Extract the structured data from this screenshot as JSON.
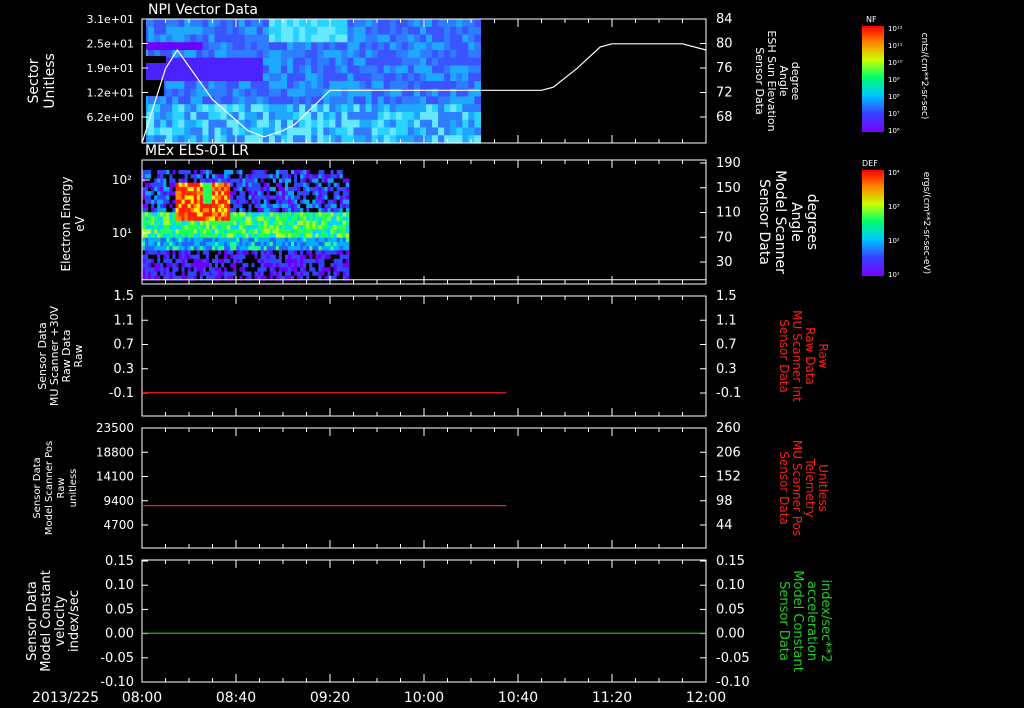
{
  "colors": {
    "white": "#ffffff",
    "red": "#ff1a1a",
    "green": "#22cc22",
    "bg": "#000000"
  },
  "date_label": "2013/225",
  "time_ticks": [
    "08:00",
    "08:40",
    "09:20",
    "10:00",
    "10:40",
    "11:20",
    "12:00"
  ],
  "time_range": [
    "08:00",
    "12:00"
  ],
  "colorbars": [
    {
      "name": "NF",
      "units": "cnts/(cm**2-sr-sec)",
      "ticks": [
        "10¹²",
        "10¹¹",
        "10¹⁰",
        "10⁹",
        "10⁸",
        "10⁷",
        "10⁶"
      ]
    },
    {
      "name": "DEF",
      "units": "ergs/(cm**2-sr-sec-eV)",
      "ticks": [
        "10⁴",
        "10³",
        "10²",
        "10¹"
      ]
    }
  ],
  "chart_data": [
    {
      "type": "heatmap",
      "title": "NPI Vector Data",
      "ylabel": [
        "Sector",
        "Unitless"
      ],
      "yticks": [
        "3.1e+01",
        "2.5e+01",
        "1.9e+01",
        "1.2e+01",
        "6.2e+00"
      ],
      "data_end": "10:24",
      "overlay": {
        "ylabel": [
          "Sensor Data",
          "ESH Sun Elevation",
          "Angle",
          "degree"
        ],
        "ylim": [
          64,
          84
        ],
        "yticks": [
          "84",
          "80",
          "76",
          "72",
          "68"
        ],
        "x": [
          "08:00",
          "08:10",
          "08:15",
          "08:30",
          "08:45",
          "08:52",
          "09:00",
          "09:05",
          "09:20",
          "10:50",
          "10:55",
          "11:05",
          "11:15",
          "11:20",
          "11:50",
          "12:00"
        ],
        "values": [
          64,
          76,
          79,
          71,
          66,
          65,
          66,
          67,
          72.5,
          72.5,
          73,
          76,
          79.5,
          80,
          80,
          79
        ]
      }
    },
    {
      "type": "heatmap",
      "title": "MEx ELS-01 LR",
      "ylabel": [
        "Electron Energy",
        "eV"
      ],
      "yticks": [
        "10²",
        "10¹"
      ],
      "data_end": "09:28",
      "overlay": {
        "ylabel": [
          "Sensor Data",
          "Model Scanner",
          "Angle",
          "degrees"
        ],
        "ylim": [
          10,
          190
        ],
        "yticks": [
          "190",
          "150",
          "110",
          "70",
          "30"
        ],
        "x": [
          "08:00",
          "12:00"
        ],
        "values": [
          10.5,
          10.5
        ]
      }
    },
    {
      "type": "line",
      "ylabel": [
        "Sensor Data",
        "MU Scanner +30V",
        "Raw Data",
        "Raw"
      ],
      "ylim": [
        -0.3,
        1.5
      ],
      "yticks": [
        "1.5",
        "1.1",
        "0.7",
        "0.3",
        "-0.1"
      ],
      "series": [
        {
          "x": [
            "08:00",
            "10:35"
          ],
          "values": [
            0.05,
            0.05
          ]
        }
      ],
      "right": {
        "ylabel": [
          "Sensor Data",
          "MU Scanner Int",
          "Raw Data",
          "Raw"
        ],
        "yticks": [
          "1.5",
          "1.1",
          "0.7",
          "0.3",
          "-0.1"
        ]
      }
    },
    {
      "type": "line",
      "ylabel": [
        "Sensor Data",
        "Model Scanner Pos",
        "Raw",
        "unitless"
      ],
      "ylim": [
        0,
        23500
      ],
      "yticks": [
        "23500",
        "18800",
        "14100",
        "9400",
        "4700"
      ],
      "series": [
        {
          "x": [
            "08:00",
            "10:35"
          ],
          "values": [
            8300,
            8300
          ]
        }
      ],
      "right": {
        "ylabel": [
          "Sensor Data",
          "MU Scanner Pos",
          "Telemetry",
          "Unitless"
        ],
        "yticks": [
          "260",
          "206",
          "152",
          "98",
          "44"
        ]
      }
    },
    {
      "type": "line",
      "ylabel": [
        "Sensor Data",
        "Model Constant",
        "velocity",
        "index/sec"
      ],
      "ylim": [
        -0.1,
        0.15
      ],
      "yticks": [
        "0.15",
        "0.10",
        "0.05",
        "0.00",
        "-0.05",
        "-0.10"
      ],
      "series": [
        {
          "x": [
            "08:00",
            "12:00"
          ],
          "values": [
            0.0,
            0.0
          ]
        }
      ],
      "right": {
        "ylabel": [
          "Sensor Data",
          "Model Constant",
          "acceleration",
          "index/sec**2"
        ],
        "yticks": [
          "0.15",
          "0.10",
          "0.05",
          "0.00",
          "-0.05",
          "-0.10"
        ]
      }
    }
  ]
}
